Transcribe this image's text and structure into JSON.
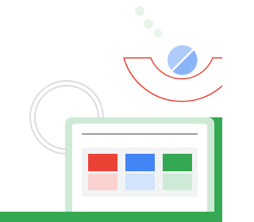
{
  "illustration": {
    "subject": "laptop-with-color-tiles",
    "decorations": [
      "dots-trail",
      "red-arc-outline",
      "gray-circle-outline",
      "blue-toggle-icon"
    ]
  },
  "colors": {
    "background": "#ffffff",
    "dot": "#e6f4ea",
    "arc_stroke": "#ea4335",
    "circle_outline": "#dadce0",
    "toggle_light": "#aecbfa",
    "toggle_dark": "#8ab4f8",
    "laptop_frame": "#34a853",
    "laptop_bezel": "#ceead6",
    "screen_bg": "#f1f3f4",
    "screen_line": "#9aa0a6",
    "tile_red": "#ea4335",
    "tile_red_light": "#fad2cf",
    "tile_blue": "#4285f4",
    "tile_blue_light": "#d2e3fc",
    "tile_green": "#34a853",
    "tile_green_light": "#ceead6"
  },
  "tiles": [
    {
      "name": "red",
      "top": "tile_red",
      "bottom": "tile_red_light"
    },
    {
      "name": "blue",
      "top": "tile_blue",
      "bottom": "tile_blue_light"
    },
    {
      "name": "green",
      "top": "tile_green",
      "bottom": "tile_green_light"
    }
  ]
}
